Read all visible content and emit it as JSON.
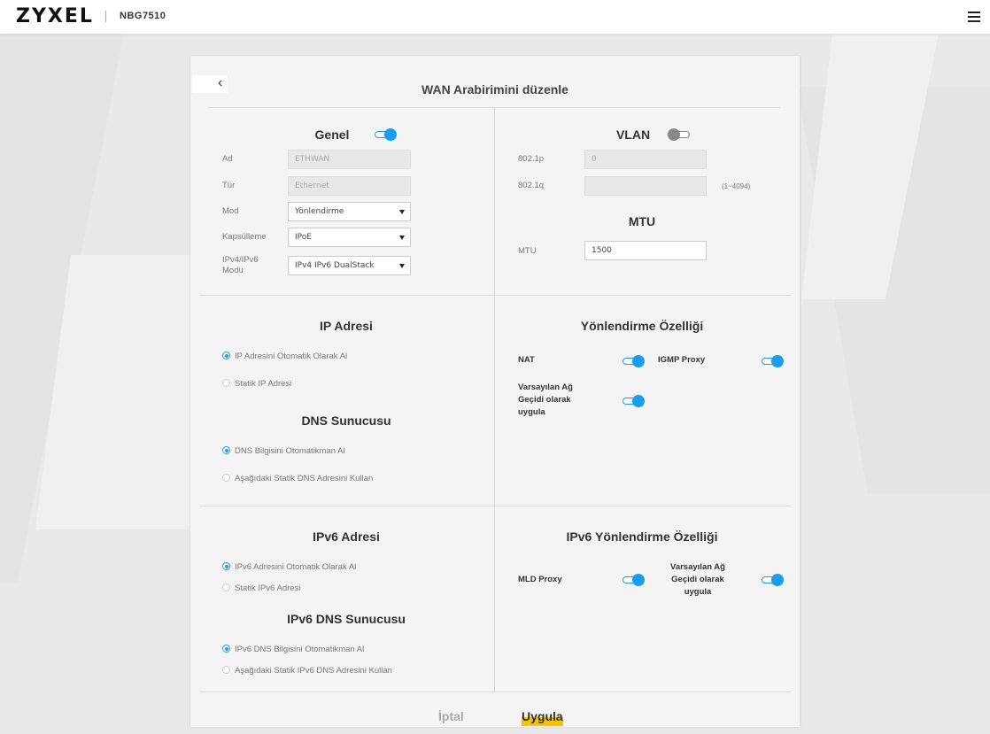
{
  "header": {
    "logo": "ZYXEL",
    "model": "NBG7510"
  },
  "page": {
    "title": "WAN Arabirimini düzenle",
    "back_glyph": "‹"
  },
  "general": {
    "title": "Genel",
    "enabled": true,
    "name_label": "Ad",
    "name_value": "ETHWAN",
    "type_label": "Tür",
    "type_value": "Ethernet",
    "mode_label": "Mod",
    "mode_value": "Yönlendirme",
    "encap_label": "Kapsülleme",
    "encap_value": "IPoE",
    "ipmode_label_1": "IPv4/IPv6",
    "ipmode_label_2": "Modu",
    "ipmode_value": "IPv4 IPv6 DualStack"
  },
  "vlan": {
    "title": "VLAN",
    "enabled": false,
    "p_label": "802.1p",
    "p_value": "0",
    "q_label": "802.1q",
    "q_value": "",
    "q_hint": "(1~4094)"
  },
  "mtu": {
    "title": "MTU",
    "label": "MTU",
    "value": "1500"
  },
  "ip": {
    "title": "IP Adresi",
    "auto": "IP Adresini Otomatik Olarak Al",
    "static": "Statik IP Adresi"
  },
  "dns": {
    "title": "DNS Sunucusu",
    "auto": "DNS Bilgisini Otomatikman Al",
    "static": "Aşağıdaki Statik DNS Adresini Kullan"
  },
  "routing": {
    "title": "Yönlendirme Özelliği",
    "nat": "NAT",
    "igmp": "IGMP Proxy",
    "default_gw_1": "Varsayılan Ağ",
    "default_gw_2": "Geçidi olarak",
    "default_gw_3": "uygula"
  },
  "ipv6": {
    "title": "IPv6 Adresi",
    "auto": "IPv6 Adresini Otomatik Olarak Al",
    "static": "Statik IPv6 Adresi"
  },
  "ipv6dns": {
    "title": "IPv6 DNS Sunucusu",
    "auto": "IPv6 DNS Bilgisini Otomatikman Al",
    "static": "Aşağıdaki Statik IPv6 DNS Adresini Kullan"
  },
  "ipv6routing": {
    "title": "IPv6 Yönlendirme Özelliği",
    "mld": "MLD Proxy",
    "default_gw_1": "Varsayılan Ağ",
    "default_gw_2": "Geçidi olarak",
    "default_gw_3": "uygula"
  },
  "actions": {
    "cancel": "İptal",
    "apply": "Uygula"
  },
  "colors": {
    "accent": "#1a9cf0",
    "apply_highlight": "#f5c400"
  }
}
